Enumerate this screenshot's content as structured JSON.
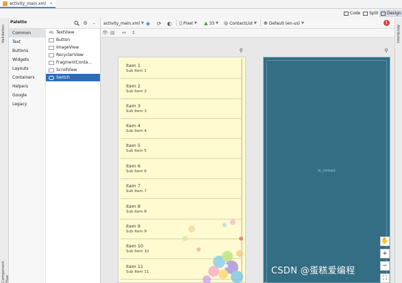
{
  "file_tab": {
    "name": "activity_main.xml"
  },
  "view_modes": {
    "code": "Code",
    "split": "Split",
    "design": "Design"
  },
  "side_tools": {
    "validation": "Validation",
    "attributes": "Attributes",
    "component_tree": "Component Tree"
  },
  "palette": {
    "title": "Palette",
    "categories": [
      "Common",
      "Text",
      "Buttons",
      "Widgets",
      "Layouts",
      "Containers",
      "Helpers",
      "Google",
      "Legacy"
    ],
    "selected_category": "Common",
    "widgets": [
      {
        "label": "TextView",
        "icon": "Ab"
      },
      {
        "label": "Button",
        "icon": "btn"
      },
      {
        "label": "ImageView",
        "icon": "img"
      },
      {
        "label": "RecyclerView",
        "icon": "list"
      },
      {
        "label": "FragmentConta...",
        "icon": "frag"
      },
      {
        "label": "ScrollView",
        "icon": "scroll"
      },
      {
        "label": "Switch",
        "icon": "toggle"
      }
    ],
    "selected_widget": "Switch"
  },
  "toolbar": {
    "file": "activity_main.xml",
    "device": "Pixel",
    "api": "33",
    "theme": "ContactList",
    "locale": "Default (en-us)",
    "warning": "!"
  },
  "list_items": [
    {
      "title": "Item 1",
      "sub": "Sub Item 1"
    },
    {
      "title": "Item 2",
      "sub": "Sub Item 2"
    },
    {
      "title": "Item 3",
      "sub": "Sub Item 3"
    },
    {
      "title": "Item 4",
      "sub": "Sub Item 4"
    },
    {
      "title": "Item 5",
      "sub": "Sub Item 5"
    },
    {
      "title": "Item 6",
      "sub": "Sub Item 6"
    },
    {
      "title": "Item 7",
      "sub": "Sub Item 7"
    },
    {
      "title": "Item 8",
      "sub": "Sub Item 8"
    },
    {
      "title": "Item 9",
      "sub": "Sub Item 9"
    },
    {
      "title": "Item 10",
      "sub": "Sub Item 10"
    },
    {
      "title": "Item 11",
      "sub": "Sub Item 11"
    }
  ],
  "blueprint": {
    "label": "lv_contact"
  },
  "zoom": {
    "in": "+",
    "out": "−"
  },
  "watermark": "CSDN @蛋糕爱编程",
  "colors": {
    "preview_bg": "#fffad0",
    "blueprint_bg": "#336e85",
    "selection": "#2d6cbd"
  }
}
